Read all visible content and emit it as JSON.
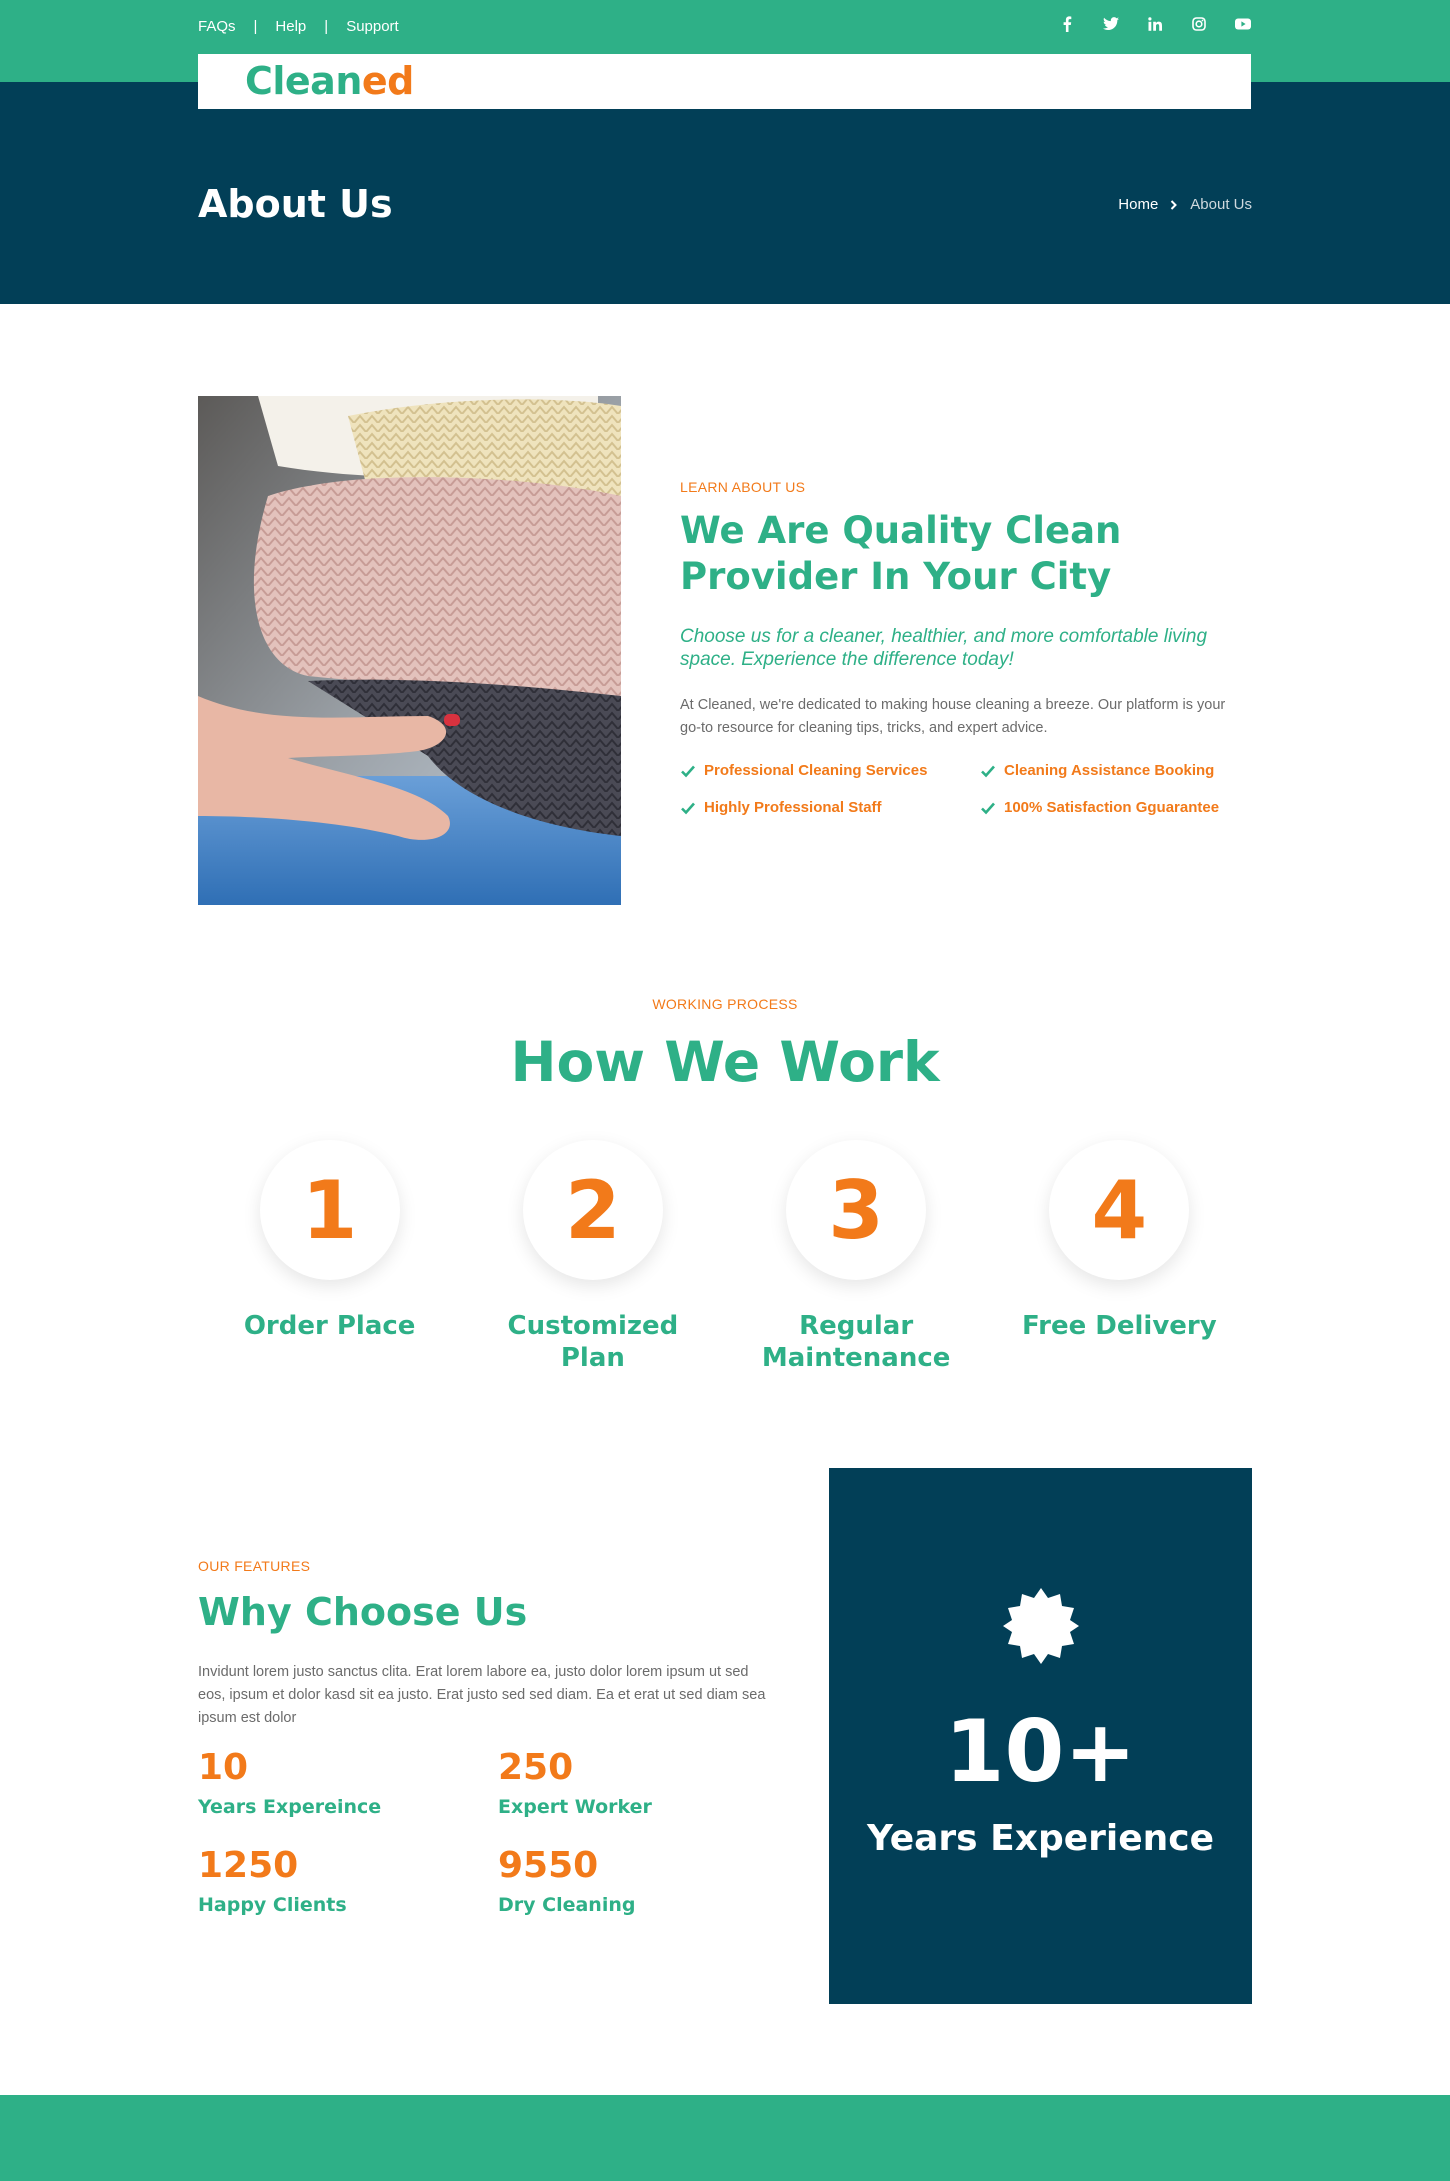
{
  "topbar": {
    "links": [
      "FAQs",
      "Help",
      "Support"
    ],
    "separator": "|",
    "socials": [
      "facebook-icon",
      "twitter-icon",
      "linkedin-icon",
      "instagram-icon",
      "youtube-icon"
    ]
  },
  "brand": {
    "part1": "Clean",
    "part2": "ed"
  },
  "header": {
    "title": "About Us",
    "breadcrumb": {
      "home": "Home",
      "current": "About Us"
    }
  },
  "about": {
    "eyebrow": "LEARN ABOUT US",
    "title": "We Are Quality Clean Provider In Your City",
    "lead": "Choose us for a cleaner, healthier, and more comfortable living space. Experience the difference today!",
    "body": "At Cleaned, we're dedicated to making house cleaning a breeze. Our platform is your go-to resource for cleaning tips, tricks, and expert advice.",
    "checks": [
      "Professional Cleaning Services",
      "Cleaning Assistance Booking",
      "Highly Professional Staff",
      "100% Satisfaction Gguarantee"
    ]
  },
  "work": {
    "eyebrow": "WORKING PROCESS",
    "title": "How We Work",
    "steps": [
      {
        "num": "1",
        "label": "Order Place"
      },
      {
        "num": "2",
        "label": "Customized Plan"
      },
      {
        "num": "3",
        "label": "Regular Maintenance"
      },
      {
        "num": "4",
        "label": "Free Delivery"
      }
    ]
  },
  "features": {
    "eyebrow": "OUR FEATURES",
    "title": "Why Choose Us",
    "body": "Invidunt lorem justo sanctus clita. Erat lorem labore ea, justo dolor lorem ipsum ut sed eos, ipsum et dolor kasd sit ea justo. Erat justo sed sed diam. Ea et erat ut sed diam sea ipsum est dolor",
    "stats": [
      {
        "num": "10",
        "label": "Years Expereince"
      },
      {
        "num": "250",
        "label": "Expert Worker"
      },
      {
        "num": "1250",
        "label": "Happy Clients"
      },
      {
        "num": "9550",
        "label": "Dry Cleaning"
      }
    ]
  },
  "experience": {
    "icon": "badge-icon",
    "num": "10+",
    "label": "Years Experience"
  },
  "colors": {
    "green": "#2eb087",
    "navy": "#023f57",
    "orange": "#f27a1a"
  }
}
